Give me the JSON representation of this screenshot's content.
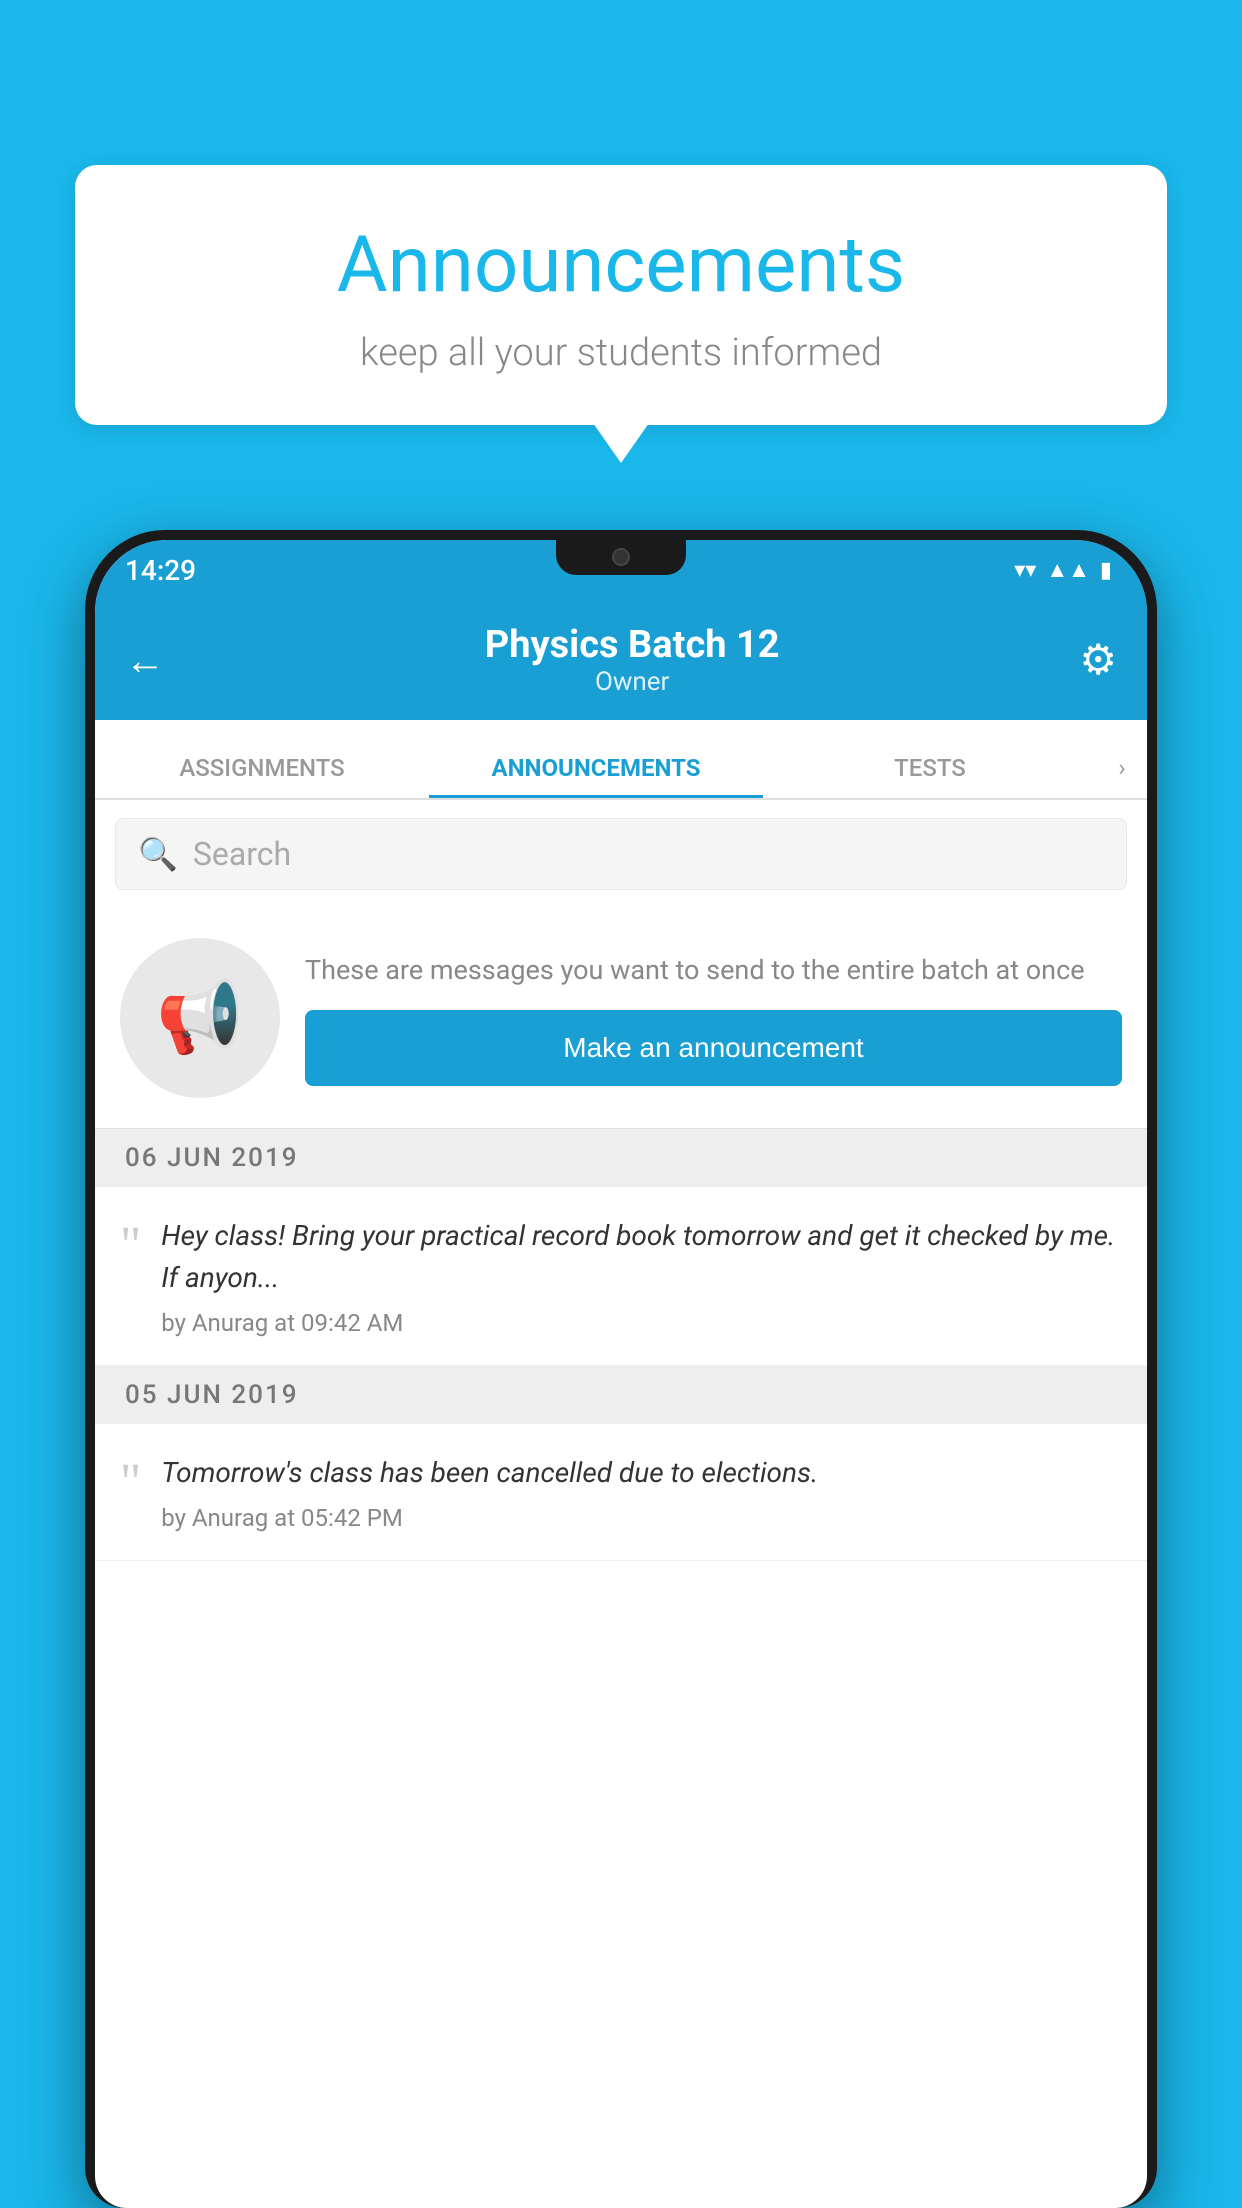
{
  "background_color": "#1ab7ea",
  "speech_bubble": {
    "title": "Announcements",
    "subtitle": "keep all your students informed"
  },
  "phone": {
    "status_bar": {
      "time": "14:29",
      "icons": [
        "wifi",
        "signal",
        "battery"
      ]
    },
    "app_bar": {
      "title": "Physics Batch 12",
      "subtitle": "Owner",
      "back_label": "←",
      "settings_label": "⚙"
    },
    "tabs": [
      {
        "label": "ASSIGNMENTS",
        "active": false
      },
      {
        "label": "ANNOUNCEMENTS",
        "active": true
      },
      {
        "label": "TESTS",
        "active": false
      }
    ],
    "search": {
      "placeholder": "Search"
    },
    "promo": {
      "description": "These are messages you want to send to the entire batch at once",
      "button_label": "Make an announcement"
    },
    "announcements": [
      {
        "date": "06  JUN  2019",
        "text": "Hey class! Bring your practical record book tomorrow and get it checked by me. If anyon...",
        "meta": "by Anurag at 09:42 AM"
      },
      {
        "date": "05  JUN  2019",
        "text": "Tomorrow's class has been cancelled due to elections.",
        "meta": "by Anurag at 05:42 PM"
      }
    ]
  }
}
